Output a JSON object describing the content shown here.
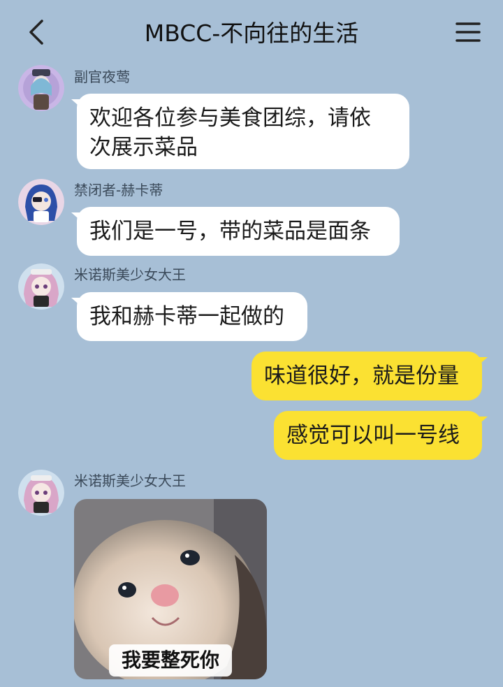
{
  "header": {
    "title": "MBCC-不向往的生活",
    "back_icon": "chevron-left-icon",
    "menu_icon": "hamburger-menu-icon"
  },
  "colors": {
    "background": "#a7bfd6",
    "incoming_bubble": "#ffffff",
    "outgoing_bubble": "#fbe132"
  },
  "messages": [
    {
      "sender": "副官夜莺",
      "text_line1": "欢迎各位参与美食团综，请依",
      "text_line2": "次展示菜品"
    },
    {
      "sender": "禁闭者-赫卡蒂",
      "text": "我们是一号，带的菜品是面条"
    },
    {
      "sender": "米诺斯美少女大王",
      "text": "我和赫卡蒂一起做的"
    },
    {
      "sender": "me",
      "text": "味道很好，就是份量"
    },
    {
      "sender": "me",
      "text": "感觉可以叫一号线"
    },
    {
      "sender": "米诺斯美少女大王",
      "sticker_caption": "我要整死你"
    }
  ]
}
